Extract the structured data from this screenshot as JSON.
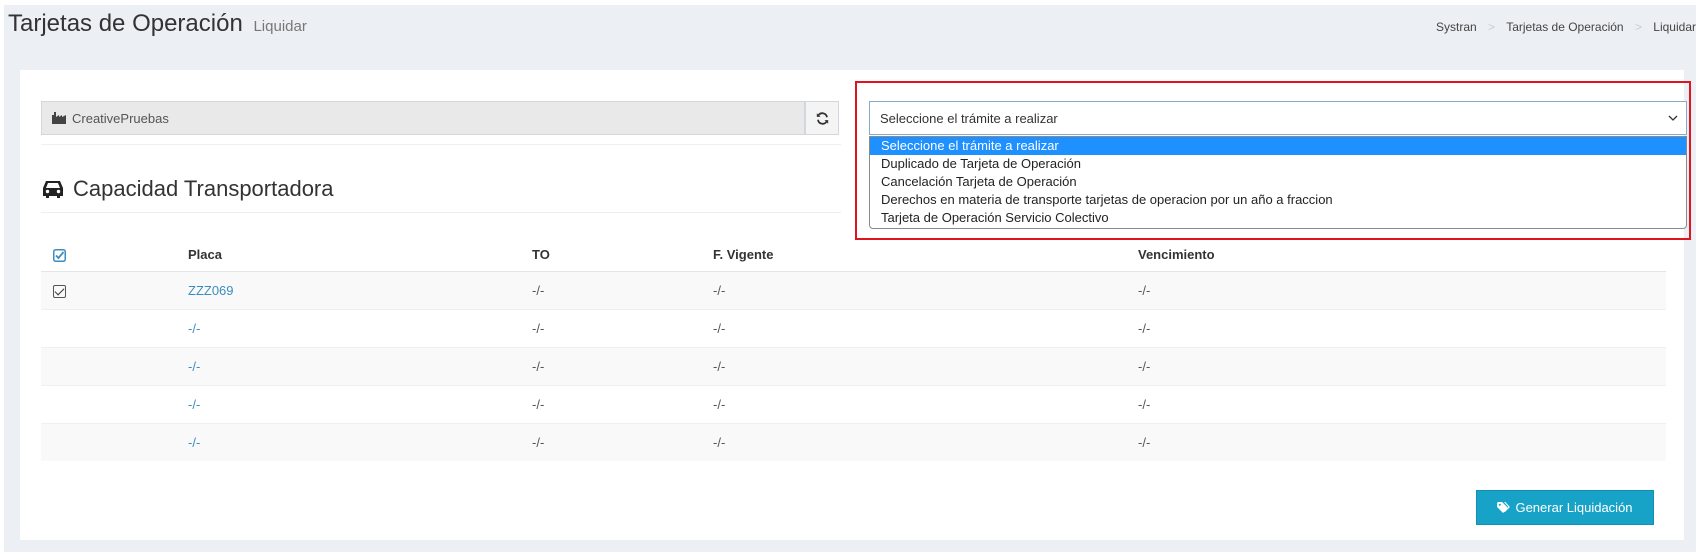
{
  "header": {
    "title": "Tarjetas de Operación",
    "subtitle": "Liquidar",
    "breadcrumb": [
      "Systran",
      "Tarjetas de Operación",
      "Liquidar"
    ]
  },
  "company": {
    "value": "CreativePruebas",
    "icon": "industry-icon"
  },
  "refresh": {
    "icon": "refresh-icon"
  },
  "section": {
    "title": "Capacidad Transportadora",
    "icon": "car-icon"
  },
  "table": {
    "headers": [
      "Placa",
      "TO",
      "F. Vigente",
      "Vencimiento"
    ],
    "rows": [
      {
        "checked": true,
        "placa": "ZZZ069",
        "to": "-/-",
        "vigente": "-/-",
        "vencimiento": "-/-"
      },
      {
        "checked": false,
        "placa": "-/-",
        "to": "-/-",
        "vigente": "-/-",
        "vencimiento": "-/-"
      },
      {
        "checked": false,
        "placa": "-/-",
        "to": "-/-",
        "vigente": "-/-",
        "vencimiento": "-/-"
      },
      {
        "checked": false,
        "placa": "-/-",
        "to": "-/-",
        "vigente": "-/-",
        "vencimiento": "-/-"
      },
      {
        "checked": false,
        "placa": "-/-",
        "to": "-/-",
        "vigente": "-/-",
        "vencimiento": "-/-"
      }
    ]
  },
  "tramite": {
    "selected": "Seleccione el trámite a realizar",
    "options": [
      "Seleccione el trámite a realizar",
      "Duplicado de Tarjeta de Operación",
      "Cancelación Tarjeta de Operación",
      "Derechos en materia de transporte tarjetas de operacion por un año a fraccion",
      "Tarjeta de Operación Servicio Colectivo"
    ]
  },
  "actions": {
    "generate_label": "Generar Liquidación",
    "generate_icon": "tag-icon"
  },
  "colors": {
    "accent": "#17a3c8",
    "link": "#3c8dbc",
    "highlight": "#e0141e",
    "option_selected": "#1e90ff"
  }
}
